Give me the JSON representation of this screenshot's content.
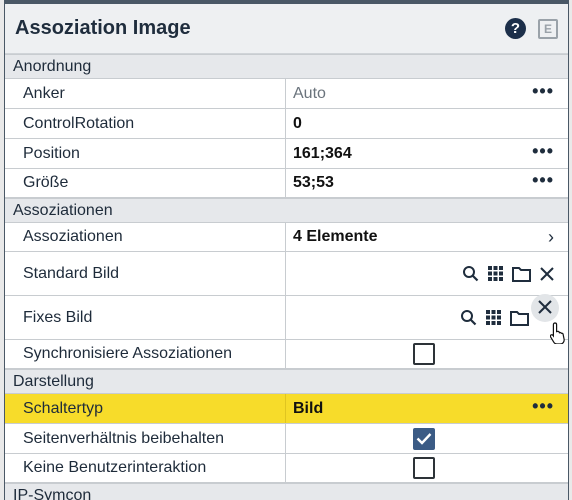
{
  "window": {
    "title": "Assoziation Image"
  },
  "sections": {
    "anordnung": "Anordnung",
    "assoziationen": "Assoziationen",
    "darstellung": "Darstellung",
    "ipsymcon": "IP-Symcon"
  },
  "rows": {
    "anker": {
      "label": "Anker",
      "value": "Auto"
    },
    "rotation": {
      "label": "ControlRotation",
      "value": "0"
    },
    "position": {
      "label": "Position",
      "value": "161;364"
    },
    "groesse": {
      "label": "Größe",
      "value": "53;53"
    },
    "assoz": {
      "label": "Assoziationen",
      "value": "4 Elemente"
    },
    "standard": {
      "label": "Standard Bild"
    },
    "fixes": {
      "label": "Fixes Bild"
    },
    "sync": {
      "label": "Synchronisiere Assoziationen",
      "checked": false
    },
    "schaltertyp": {
      "label": "Schaltertyp",
      "value": "Bild"
    },
    "seiten": {
      "label": "Seitenverhältnis beibehalten",
      "checked": true
    },
    "keine": {
      "label": "Keine Benutzerinteraktion",
      "checked": false
    }
  },
  "icons": {
    "help": "?",
    "edit": "E",
    "more": "•••",
    "chevron": "›"
  },
  "colors": {
    "highlight": "#f7dc2a",
    "checkbox_checked": "#3b5b85",
    "help_bg": "#1c2f4a"
  }
}
